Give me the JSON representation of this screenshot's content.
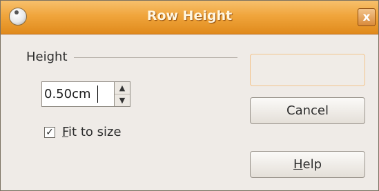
{
  "window": {
    "title": "Row Height",
    "close_label": "x"
  },
  "height_group": {
    "label": "Height",
    "value": "0.50cm",
    "spin_up": "▲",
    "spin_down": "▼"
  },
  "fit_to_size": {
    "label_first": "F",
    "label_rest": "it to size",
    "checked_mark": "✓"
  },
  "buttons": {
    "ok_label": "",
    "cancel_label": "Cancel",
    "help_label_first": "H",
    "help_label_rest": "elp"
  }
}
